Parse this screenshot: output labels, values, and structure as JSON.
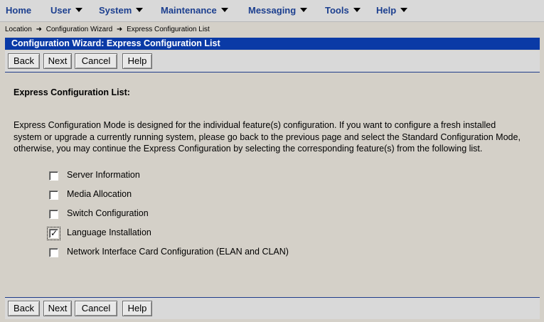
{
  "menu": {
    "items": [
      {
        "label": "Home",
        "caret": false
      },
      {
        "label": "User",
        "caret": true
      },
      {
        "label": "System",
        "caret": true
      },
      {
        "label": "Maintenance",
        "caret": true
      },
      {
        "label": "Messaging",
        "caret": true
      },
      {
        "label": "Tools",
        "caret": true
      },
      {
        "label": "Help",
        "caret": true
      }
    ]
  },
  "breadcrumb": {
    "location": "Location",
    "step1": "Configuration Wizard",
    "step2": "Express Configuration List"
  },
  "title": "Configuration Wizard: Express Configuration List",
  "buttons": {
    "back": "Back",
    "next": "Next",
    "cancel": "Cancel",
    "help": "Help"
  },
  "content": {
    "heading": "Express Configuration List:",
    "description": "Express Configuration Mode is designed for the individual feature(s) configuration. If you want to configure a fresh installed system or upgrade a currently running system, please go back to the previous page and select the Standard Configuration Mode, otherwise, you may continue the Express Configuration by selecting the corresponding feature(s) from the following list."
  },
  "options": [
    {
      "label": "Server Information",
      "checked": false
    },
    {
      "label": "Media Allocation",
      "checked": false
    },
    {
      "label": "Switch Configuration",
      "checked": false
    },
    {
      "label": "Language Installation",
      "checked": true
    },
    {
      "label": "Network Interface Card Configuration (ELAN and CLAN)",
      "checked": false
    }
  ],
  "icons": {
    "menu_caret": "chevron-down-icon",
    "breadcrumb_separator": "arrow-right-icon",
    "check": "checkmark-icon"
  },
  "colors": {
    "title_bar": "#0a3aa6",
    "menu_text": "#1c3f8f",
    "background": "#d4d0c8"
  }
}
